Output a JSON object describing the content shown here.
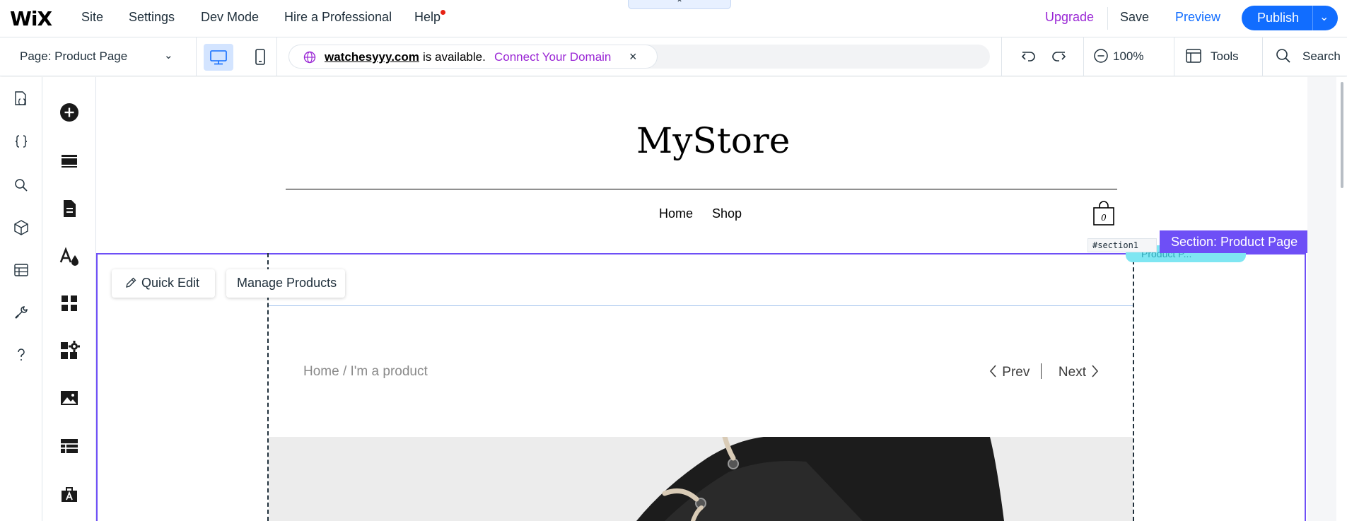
{
  "topbar": {
    "logo": "WiX",
    "menu": [
      "Site",
      "Settings",
      "Dev Mode",
      "Hire a Professional",
      "Help"
    ],
    "collapse_glyph": "⌃",
    "upgrade": "Upgrade",
    "save": "Save",
    "preview": "Preview",
    "publish": "Publish",
    "publish_chevron": "⌄"
  },
  "toolbar": {
    "page_prefix": "Page:",
    "page_name": "Product Page",
    "page_chevron": "⌄",
    "domain": {
      "name": "watchesyyy.com",
      "available_text": "is available.",
      "connect_link": "Connect Your Domain",
      "close": "×"
    },
    "zoom": "100%",
    "tools": "Tools",
    "search": "Search"
  },
  "site": {
    "store_title": "MyStore",
    "nav": [
      "Home",
      "Shop"
    ],
    "cart_count": "0",
    "breadcrumb": "Home / I'm a product",
    "prev": "Prev",
    "next": "Next"
  },
  "editor": {
    "section_label": "Section: Product Page",
    "anchor": "#section1",
    "widget_label": "Product P...",
    "quick_edit": "Quick Edit",
    "manage_products": "Manage Products"
  },
  "colors": {
    "accent_blue": "#116dff",
    "upgrade_purple": "#9a27d5",
    "section_purple": "#6e4ff6",
    "widget_cyan": "#7fe6f2"
  },
  "icons": {
    "left_rail": [
      "pages-icon",
      "code-icon",
      "search-icon",
      "packages-icon",
      "database-icon",
      "tools-icon",
      "help-icon"
    ],
    "left_panel": [
      "add-icon",
      "sections-icon",
      "pages-menu-icon",
      "design-icon",
      "apps-icon",
      "business-apps-icon",
      "media-icon",
      "cms-icon",
      "portfolio-icon"
    ]
  }
}
